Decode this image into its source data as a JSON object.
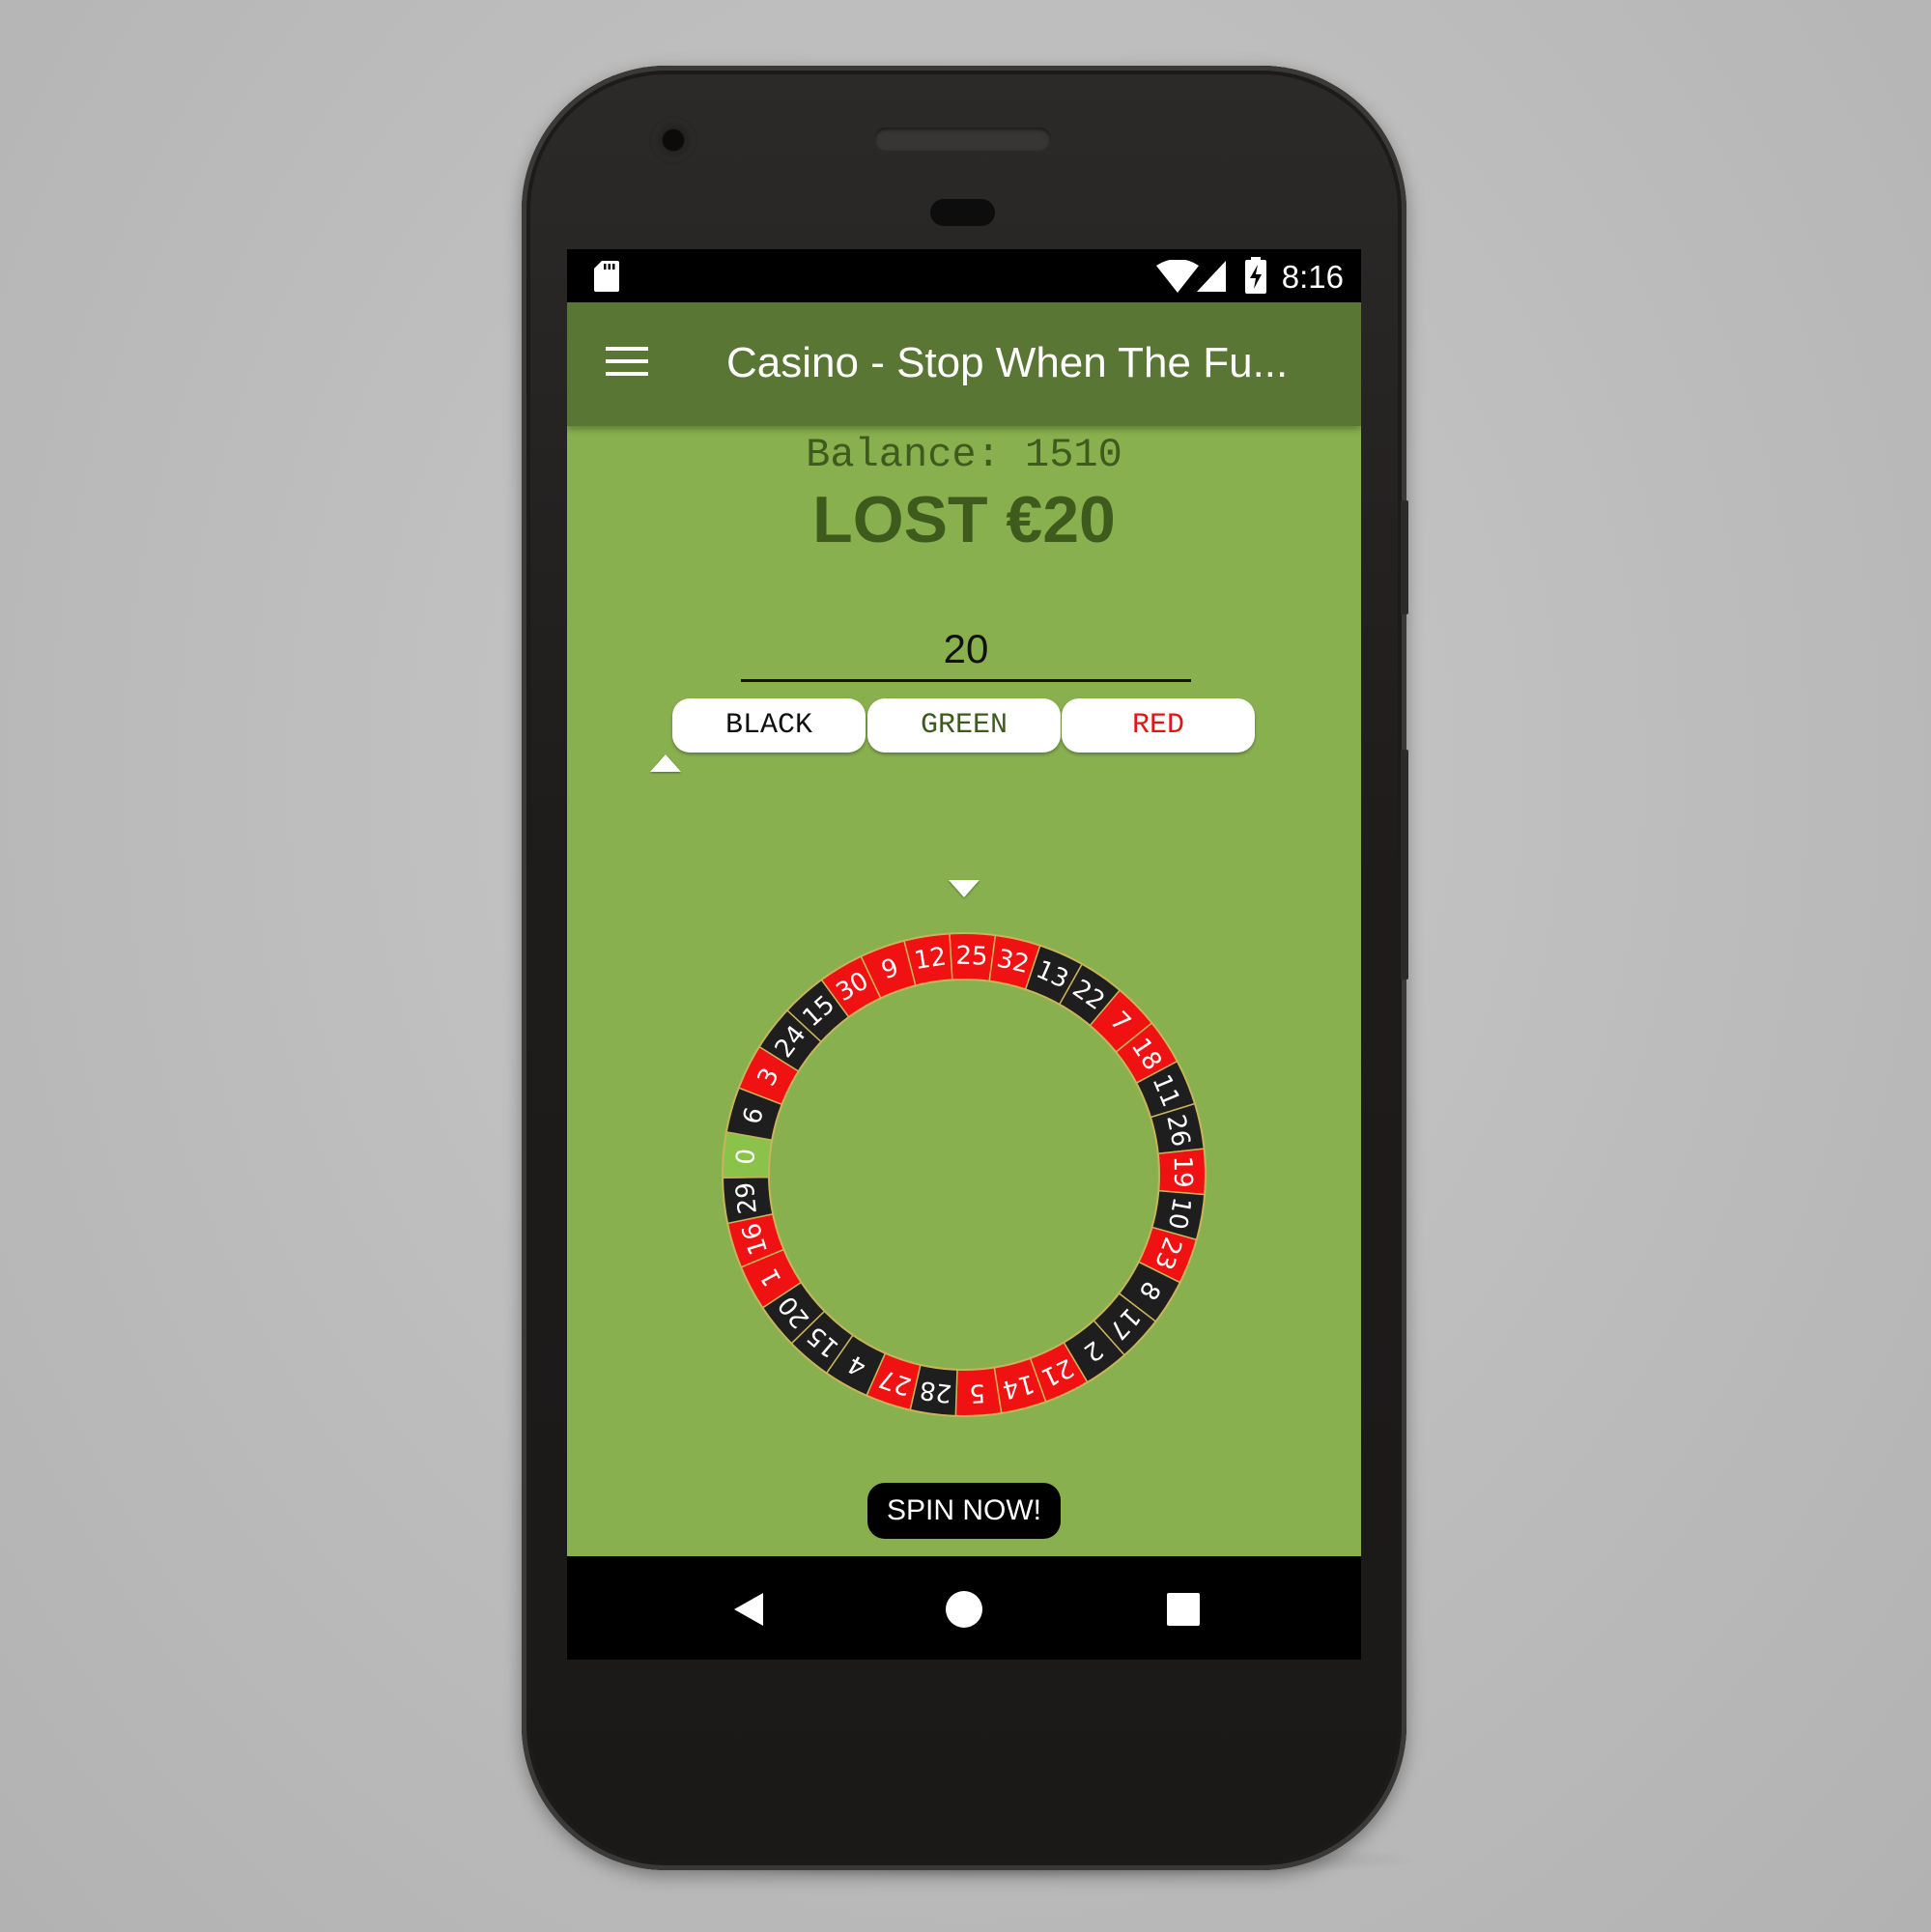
{
  "status_bar": {
    "time": "8:16",
    "icons": [
      "sd-card-icon",
      "wifi-icon",
      "cell-signal-icon",
      "battery-charging-icon"
    ]
  },
  "app_bar": {
    "title": "Casino - Stop When The Fu...",
    "menu_icon": "hamburger-menu-icon"
  },
  "game": {
    "balance_text": "Balance: 1510",
    "result_text": "LOST €20",
    "bet_value": "20",
    "color_buttons": [
      {
        "label": "BLACK",
        "color": "#111111"
      },
      {
        "label": "GREEN",
        "color": "#3f5a1d"
      },
      {
        "label": "RED",
        "color": "#e01616"
      }
    ],
    "selected_color": "BLACK",
    "spin_label": "SPIN NOW!",
    "wheel_numbers": [
      "25",
      "32",
      "13",
      "22",
      "7",
      "18",
      "11",
      "26",
      "19",
      "10",
      "23",
      "8",
      "17",
      "2",
      "21",
      "14",
      "5",
      "28",
      "27",
      "4",
      "15",
      "20",
      "1",
      "16",
      "29",
      "0",
      "6",
      "3",
      "24",
      "15",
      "30",
      "9",
      "12"
    ],
    "wheel_colors": {
      "red": "#f01212",
      "black": "#1e1e1e",
      "green": "#8bc34a",
      "border": "#c8b45a"
    }
  },
  "nav_bar": {
    "buttons": [
      "back-icon",
      "home-icon",
      "recents-icon"
    ]
  },
  "theme": {
    "background_green": "#88b04e",
    "appbar_green": "#5a7634",
    "text_dark_green": "#3f5a1d"
  }
}
